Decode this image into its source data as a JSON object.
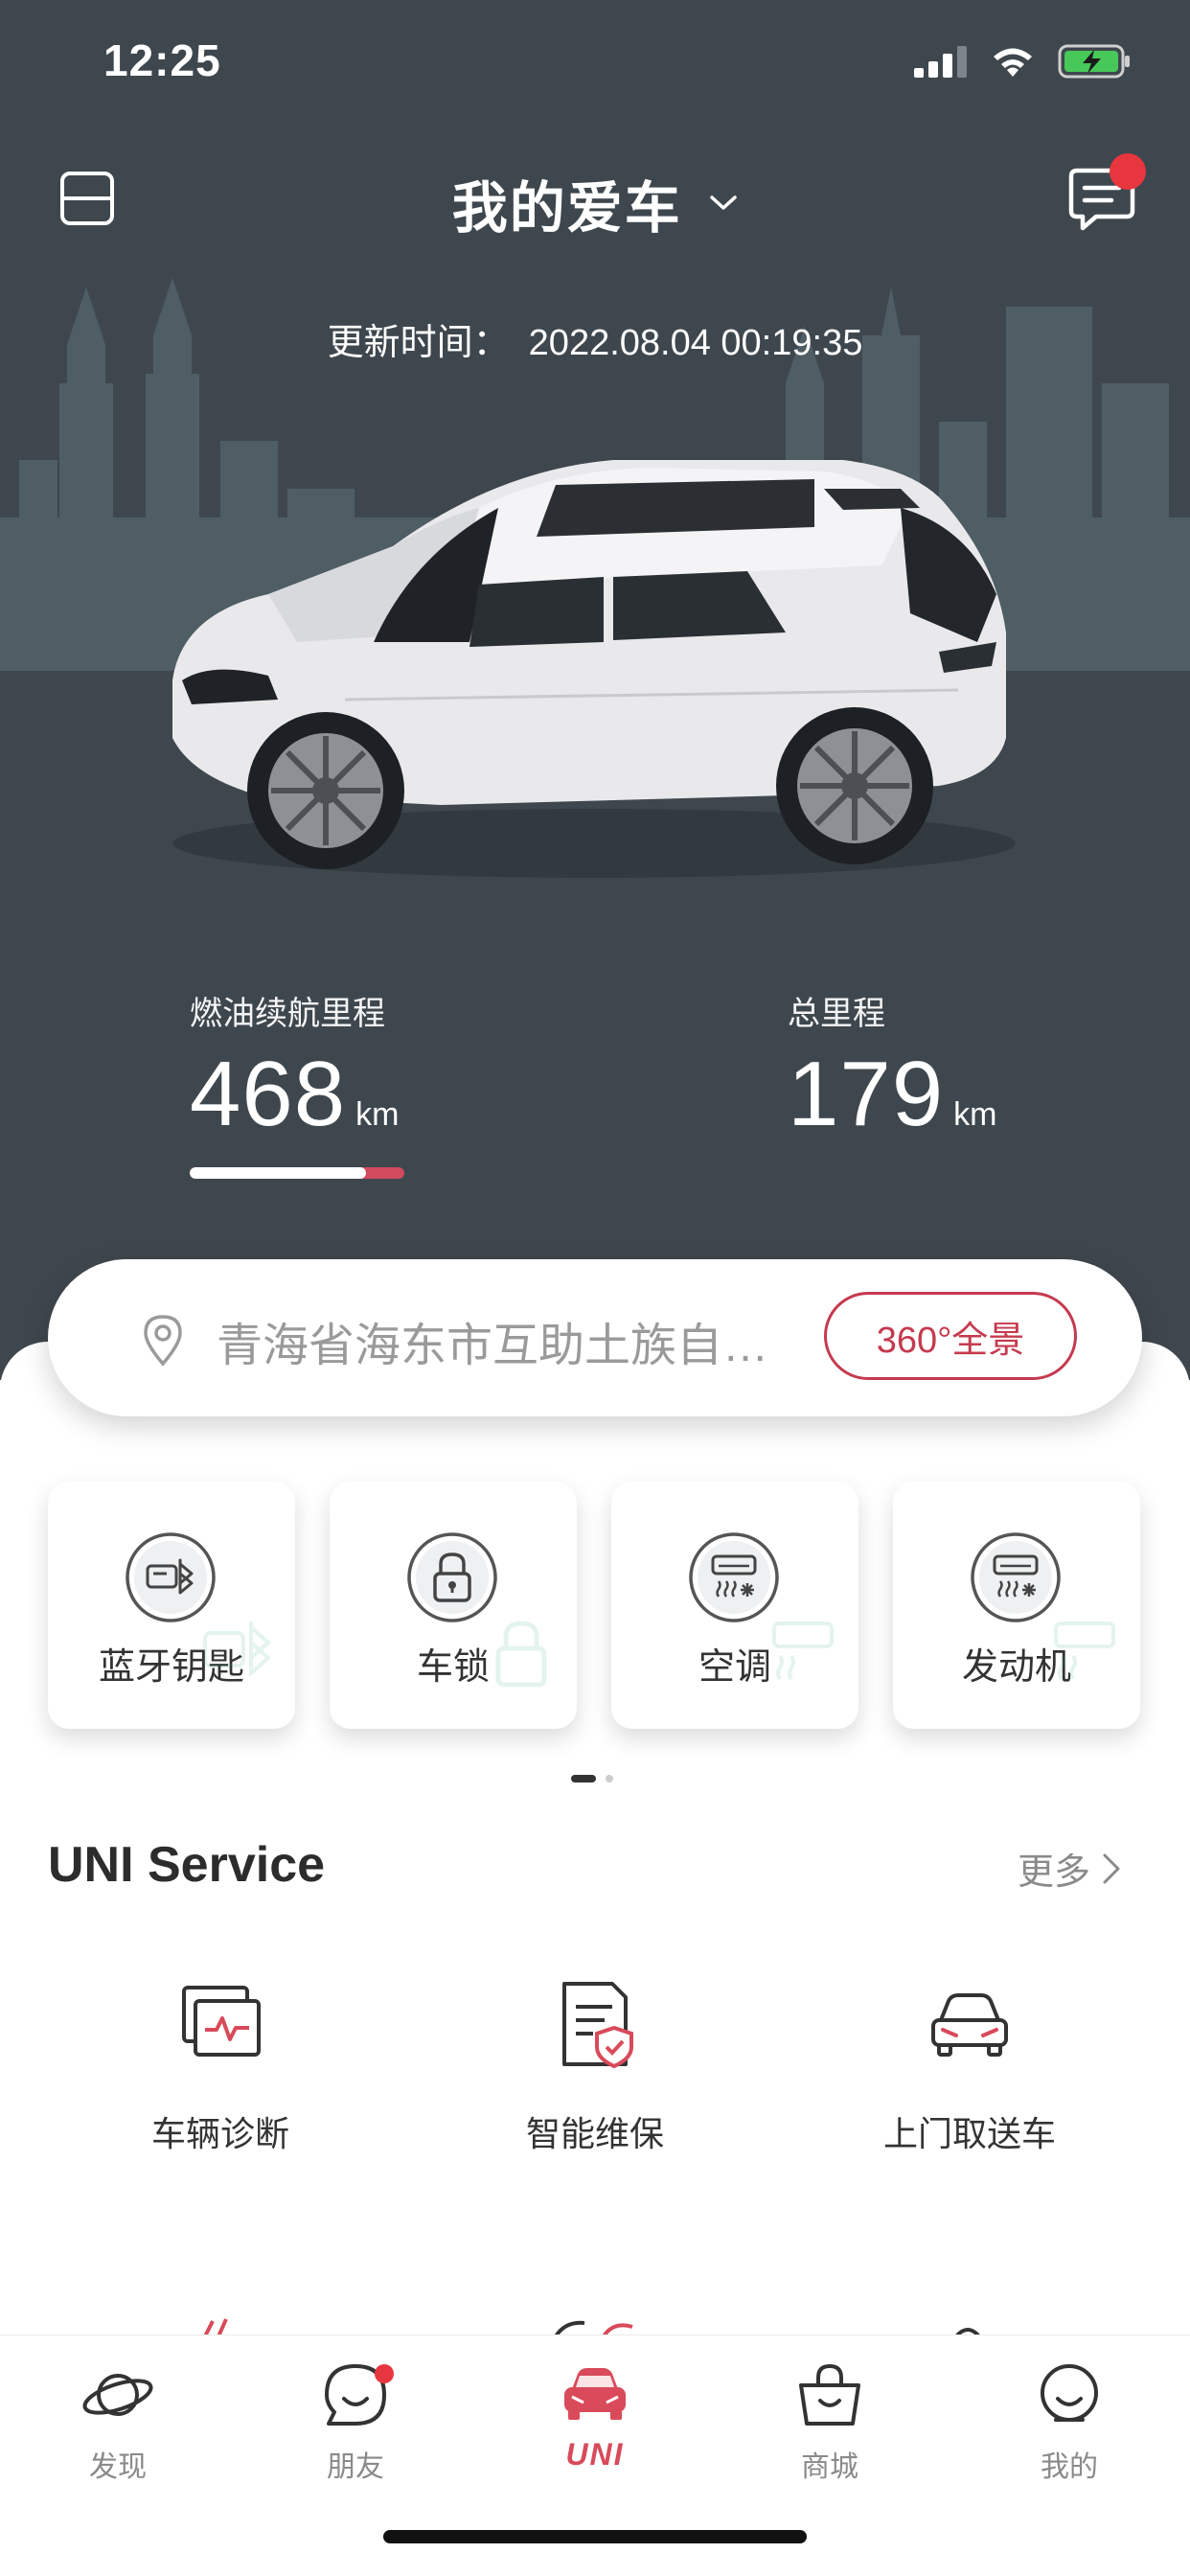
{
  "status_bar": {
    "time": "12:25"
  },
  "header": {
    "title": "我的爱车"
  },
  "update": {
    "label": "更新时间：",
    "value": "2022.08.04 00:19:35"
  },
  "stats": {
    "fuel_range": {
      "label": "燃油续航里程",
      "value": "468",
      "unit": "km",
      "fill_fraction": 0.82
    },
    "total_mileage": {
      "label": "总里程",
      "value": "179",
      "unit": "km"
    }
  },
  "location": {
    "address": "青海省海东市互助土族自…",
    "panorama_button": "360°全景"
  },
  "controls": {
    "items": [
      {
        "label": "蓝牙钥匙",
        "icon": "bluetooth-key-icon"
      },
      {
        "label": "车锁",
        "icon": "lock-icon"
      },
      {
        "label": "空调",
        "icon": "air-conditioner-icon"
      },
      {
        "label": "发动机",
        "icon": "engine-icon"
      }
    ],
    "page": 1,
    "page_count": 2
  },
  "uni_service": {
    "title": "UNI Service",
    "more_label": "更多",
    "items": [
      {
        "label": "车辆诊断",
        "icon": "vehicle-diagnosis-icon"
      },
      {
        "label": "智能维保",
        "icon": "smart-maintenance-icon"
      },
      {
        "label": "上门取送车",
        "icon": "car-pickup-icon"
      }
    ]
  },
  "tabbar": {
    "items": [
      {
        "label": "发现",
        "icon": "planet-icon"
      },
      {
        "label": "朋友",
        "icon": "chat-face-icon",
        "has_badge": true
      },
      {
        "label": "UNI",
        "icon": "car-front-icon",
        "active": true
      },
      {
        "label": "商城",
        "icon": "shopping-bag-icon"
      },
      {
        "label": "我的",
        "icon": "smile-face-icon"
      }
    ]
  },
  "colors": {
    "accent": "#c53a4e",
    "hero_background": "#3f474e",
    "badge": "#e8363f"
  }
}
